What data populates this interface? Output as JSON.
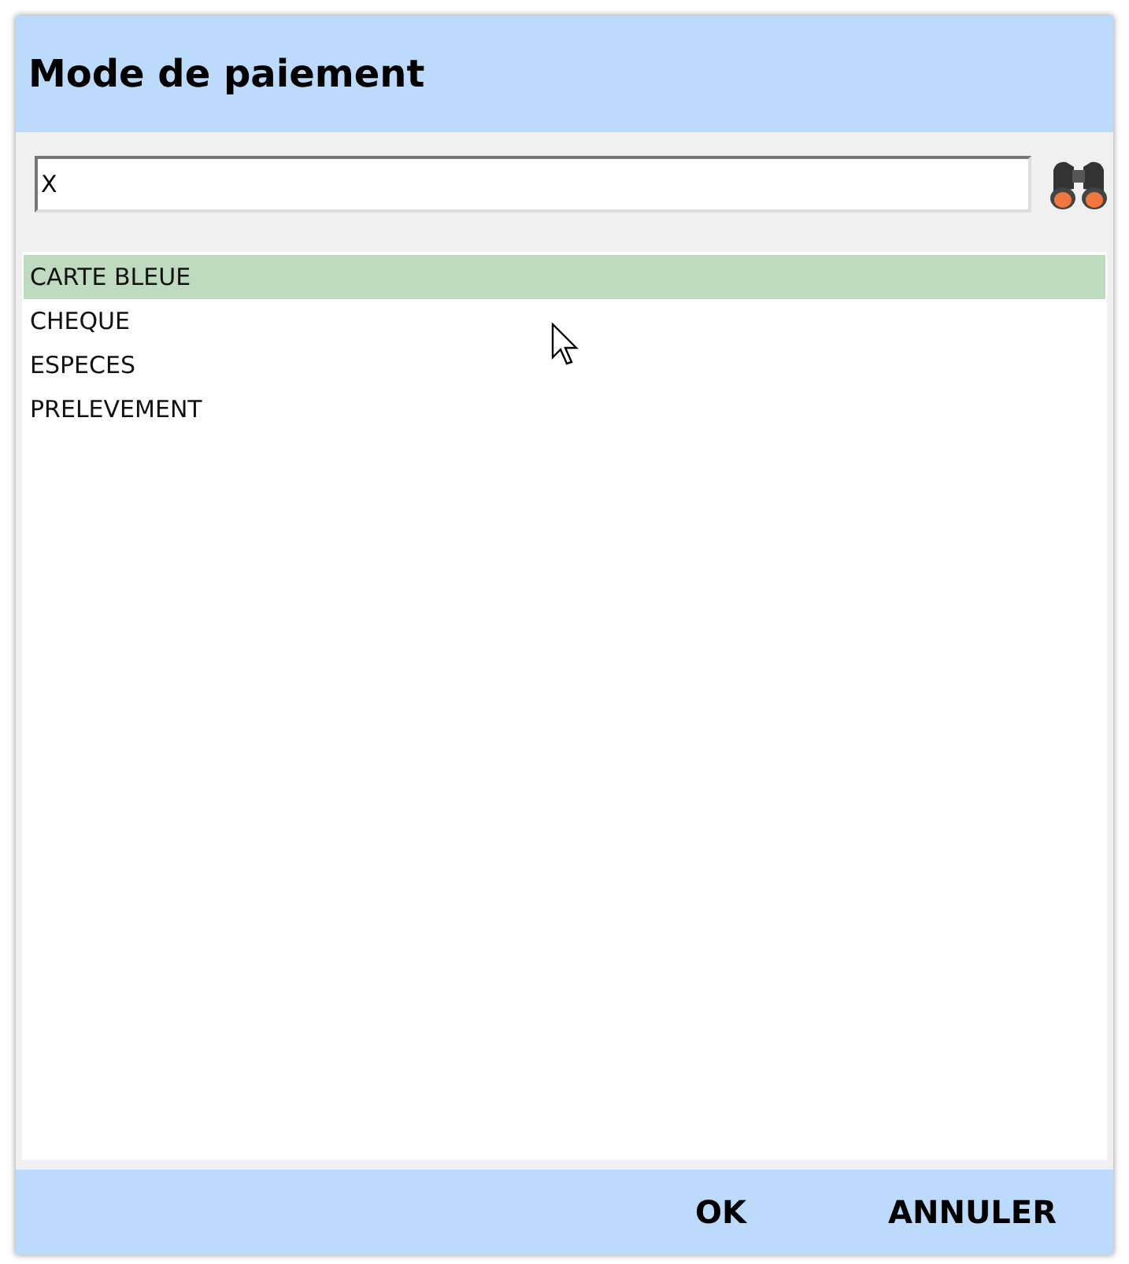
{
  "window": {
    "title": "Mode de paiement"
  },
  "search": {
    "value": "X"
  },
  "items": [
    {
      "label": "CARTE BLEUE",
      "selected": true
    },
    {
      "label": "CHEQUE",
      "selected": false
    },
    {
      "label": "ESPECES",
      "selected": false
    },
    {
      "label": "PRELEVEMENT",
      "selected": false
    }
  ],
  "buttons": [
    "OK",
    "ANNULER"
  ]
}
